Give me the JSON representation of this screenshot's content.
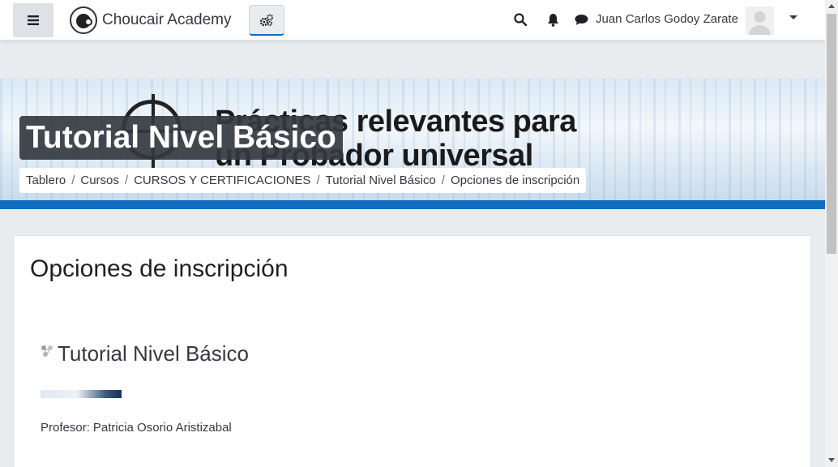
{
  "navbar": {
    "site_name": "Choucair Academy",
    "user_name": "Juan Carlos Godoy Zarate",
    "icons": {
      "drawer": "hamburger-icon",
      "admin": "cogs-icon",
      "search": "search-icon",
      "notifications": "bell-icon",
      "messages": "comment-icon",
      "user_menu": "caret-down-icon"
    }
  },
  "header": {
    "banner_text_line1": "Prácticas relevantes para",
    "banner_text_line2": "un Probador universal",
    "title": "Tutorial Nivel Básico",
    "breadcrumb": [
      {
        "label": "Tablero"
      },
      {
        "label": "Cursos"
      },
      {
        "label": "CURSOS Y CERTIFICACIONES"
      },
      {
        "label": "Tutorial Nivel Básico"
      },
      {
        "label": "Opciones de inscripción"
      }
    ],
    "separator": "/"
  },
  "main": {
    "heading": "Opciones de inscripción",
    "course": {
      "name": "Tutorial Nivel Básico",
      "teacher_label": "Profesor:",
      "teacher_name": "Patricia Osorio Aristizabal"
    }
  },
  "colors": {
    "accent": "#0f6cbf",
    "page_bg": "#e9ecef",
    "title_bg": "#343a40"
  }
}
